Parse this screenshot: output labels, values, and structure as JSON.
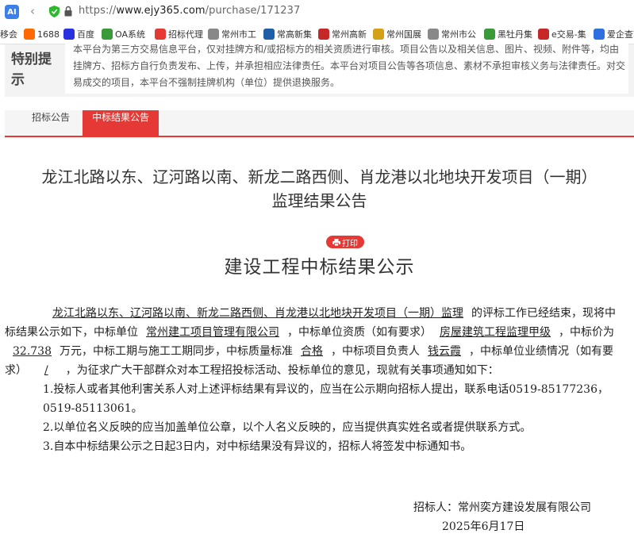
{
  "browser": {
    "app_badge": "AI",
    "url_prefix": "https://",
    "url_host": "www.ejy365.com",
    "url_path": "/purchase/171237"
  },
  "bookmarks": [
    {
      "label": "移会",
      "icon": "logo-icon",
      "color": "#888888"
    },
    {
      "label": "1688",
      "icon": "1688-icon",
      "color": "#ff6a00"
    },
    {
      "label": "百度",
      "icon": "baidu-paw-icon",
      "color": "#2932e1"
    },
    {
      "label": "OA系统",
      "icon": "oa-icon",
      "color": "#3a9a3a"
    },
    {
      "label": "招标代理",
      "icon": "pdf-icon",
      "color": "#e53935"
    },
    {
      "label": "常州市工",
      "icon": "globe-icon",
      "color": "#888888"
    },
    {
      "label": "常高新集",
      "icon": "logo-icon",
      "color": "#1f5fa8"
    },
    {
      "label": "常州高新",
      "icon": "seal-icon",
      "color": "#c62828"
    },
    {
      "label": "常州国展",
      "icon": "emblem-icon",
      "color": "#d4a017"
    },
    {
      "label": "常州市公",
      "icon": "globe-icon",
      "color": "#888888"
    },
    {
      "label": "黑牡丹集",
      "icon": "oa-icon",
      "color": "#3a9a3a"
    },
    {
      "label": "e交易-集",
      "icon": "e-icon",
      "color": "#c62828"
    },
    {
      "label": "爱企查首",
      "icon": "aiqicha-icon",
      "color": "#2f6fe0"
    }
  ],
  "notice": {
    "label": "特别提示",
    "text": "本平台为第三方交易信息平台，仅对挂牌方和/或招标方的相关资质进行审核。项目公告以及相关信息、图片、视频、附件等，均由挂牌方、招标方自行负责发布、上传，并承担相应法律责任。本平台对项目公告等各项信息、素材不承担审核义务与法律责任。对交易成交的项目，本平台不强制挂牌机构（单位）提供退换服务。"
  },
  "tabs": [
    {
      "label": "招标公告",
      "active": false
    },
    {
      "label": "中标结果公告",
      "active": true
    }
  ],
  "article": {
    "title_line1": "龙江北路以东、辽河路以南、新龙二路西侧、肖龙港以北地块开发项目（一期）",
    "title_line2": "监理结果公告",
    "print_label": "打印",
    "doc_title": "建设工程中标结果公示",
    "project_name": "龙江北路以东、辽河路以南、新龙二路西侧、肖龙港以北地块开发项目（一期）监理",
    "t1": "的评标工作已经结束，现将中标结果公示如下，中标单位",
    "winner": "常州建工项目管理有限公司",
    "t2": "，中标单位资质（如有要求）",
    "qualification": "房屋建筑工程监理甲级",
    "t3": "，中标价为",
    "price": "32.738",
    "t4": "万元，中标工期与施工工期同步，中标质量标准",
    "quality": "合格",
    "t5": "，中标项目负责人",
    "manager": "钱云霞",
    "t6": "，中标单位业绩情况（如有要求）",
    "performance": "/",
    "t7": "，为征求广大干部群众对本工程招投标活动、投标单位的意见，现就有关事项通知如下：",
    "items": [
      "1.投标人或者其他利害关系人对上述评标结果有异议的，应当在公示期向招标人提出，联系电话0519-85177236，0519-85113061。",
      "2.以单位名义反映的应当加盖单位公章，以个人名义反映的，应当提供真实姓名或者提供联系方式。",
      "3.自本中标结果公示之日起3日内，对中标结果没有异议的，招标人将签发中标通知书。"
    ],
    "signature": "招标人：常州奕方建设发展有限公司",
    "date": "2025年6月17日"
  }
}
